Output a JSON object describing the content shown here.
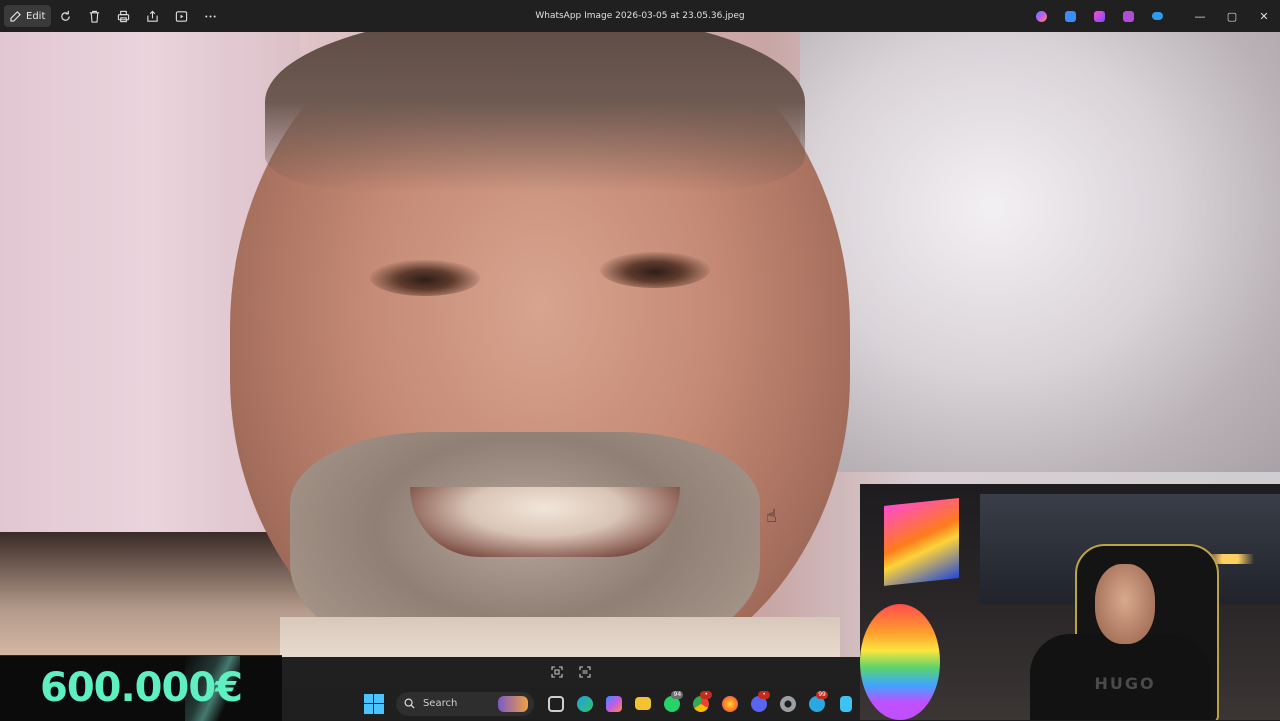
{
  "window": {
    "title": "WhatsApp Image 2026-03-05 at 23.05.36.jpeg",
    "edit_label": "Edit",
    "toolbar_icons": [
      "rotate-icon",
      "delete-icon",
      "print-icon",
      "share-icon",
      "slideshow-icon",
      "more-icon"
    ],
    "app_icons": [
      {
        "name": "copilot-icon",
        "color": "#c95cf0"
      },
      {
        "name": "designer-icon",
        "color": "#3b8cff"
      },
      {
        "name": "clipchamp-icon",
        "color": "#9a4cff"
      },
      {
        "name": "video-editor-icon",
        "color": "#b24cd6"
      },
      {
        "name": "onedrive-icon",
        "color": "#2d9bf0"
      }
    ],
    "controls": {
      "minimize": "—",
      "maximize": "▢",
      "close": "✕"
    }
  },
  "overlay": {
    "amount": "600.000€",
    "amount_color": "#5ff0c2"
  },
  "webcam": {
    "shirt_text": "HUGO"
  },
  "taskbar": {
    "search_label": "Search",
    "apps": [
      {
        "name": "task-view-icon",
        "color": "#cfcfcf",
        "badge": ""
      },
      {
        "name": "edge-icon",
        "color": "#1fa0e3",
        "badge": ""
      },
      {
        "name": "copilot-app-icon",
        "color": "#c45ae8",
        "badge": ""
      },
      {
        "name": "file-explorer-icon",
        "color": "#f2c230",
        "badge": ""
      },
      {
        "name": "whatsapp-icon",
        "color": "#25d366",
        "badge": "94"
      },
      {
        "name": "chrome-icon",
        "color": "#e94235",
        "badge": "•"
      },
      {
        "name": "firefox-icon",
        "color": "#ff7b1c",
        "badge": ""
      },
      {
        "name": "discord-icon",
        "color": "#5865f2",
        "badge": "•"
      },
      {
        "name": "settings-icon",
        "color": "#9aa0a6",
        "badge": ""
      },
      {
        "name": "vpn-icon",
        "color": "#2aa8e0",
        "badge": "99"
      },
      {
        "name": "notepad-icon",
        "color": "#3ec1f3",
        "badge": ""
      }
    ]
  }
}
